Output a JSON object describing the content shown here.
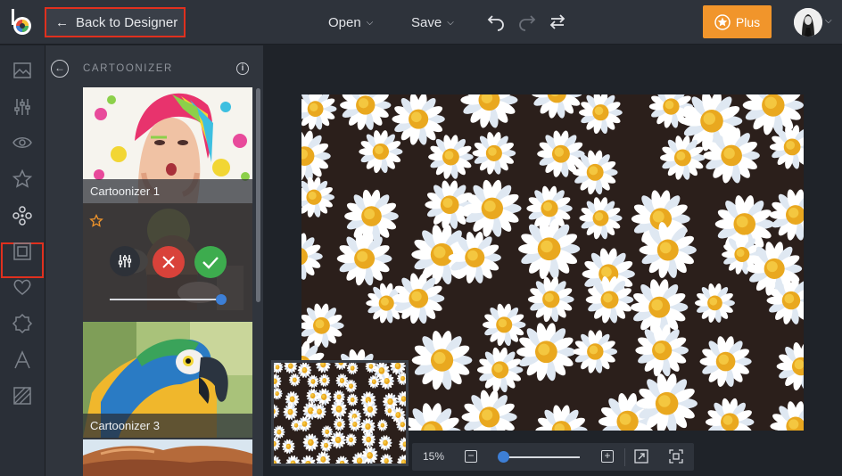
{
  "header": {
    "back_label": "Back to Designer",
    "open_label": "Open",
    "save_label": "Save",
    "plus_label": "Plus"
  },
  "panel": {
    "title": "CARTOONIZER",
    "items": [
      {
        "label": "Cartoonizer 1"
      },
      {
        "label": ""
      },
      {
        "label": "Cartoonizer 3"
      },
      {
        "label": ""
      }
    ],
    "active_slider": 1.0
  },
  "zoom": {
    "level": "15%",
    "slider": 0.05
  },
  "colors": {
    "accent": "#f1952b",
    "highlight": "#e0301e",
    "confirm": "#3dac4e",
    "cancel": "#d9423a",
    "slider": "#3d7fd6"
  },
  "icons": {
    "leftbar": [
      "image-icon",
      "adjustments-icon",
      "eye-icon",
      "star-icon",
      "effects-icon",
      "frame-icon",
      "heart-icon",
      "badge-icon",
      "text-icon",
      "texture-icon"
    ]
  }
}
